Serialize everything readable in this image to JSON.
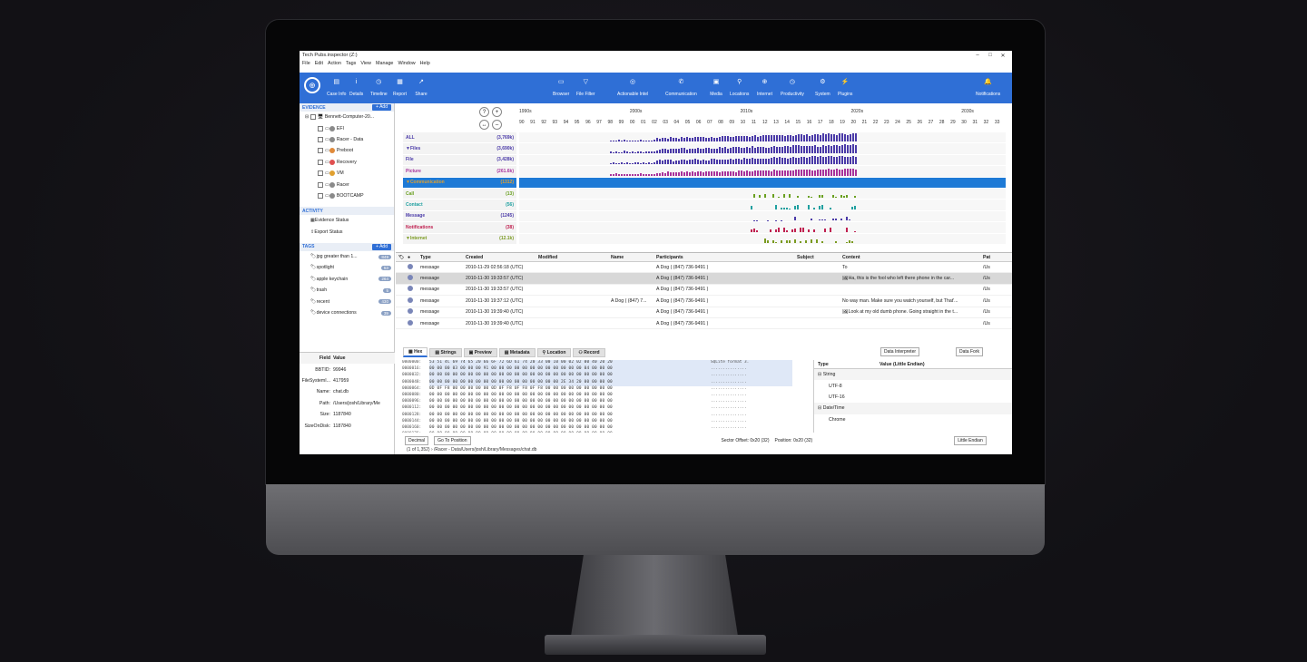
{
  "window": {
    "title": "Tech Pubs.inspector (Z:)"
  },
  "menu": [
    "File",
    "Edit",
    "Action",
    "Tags",
    "View",
    "Manage",
    "Window",
    "Help"
  ],
  "toolbar_left": [
    {
      "label": "Case Info",
      "icon": "document-icon"
    },
    {
      "label": "Details",
      "icon": "info-icon"
    },
    {
      "label": "Timeline",
      "icon": "clock-icon"
    },
    {
      "label": "Report",
      "icon": "report-icon"
    },
    {
      "label": "Share",
      "icon": "share-icon"
    }
  ],
  "toolbar_center": [
    {
      "label": "Browser",
      "icon": "folder-icon"
    },
    {
      "label": "File Filter",
      "icon": "filter-icon"
    },
    {
      "label": "Actionable Intel",
      "icon": "target-icon"
    },
    {
      "label": "Communication",
      "icon": "phone-icon"
    },
    {
      "label": "Media",
      "icon": "image-icon"
    },
    {
      "label": "Locations",
      "icon": "pin-icon"
    },
    {
      "label": "Internet",
      "icon": "globe-icon"
    },
    {
      "label": "Productivity",
      "icon": "clock-icon"
    },
    {
      "label": "System",
      "icon": "gear-icon"
    },
    {
      "label": "Plugins",
      "icon": "plug-icon"
    }
  ],
  "toolbar_right": {
    "label": "Notifications",
    "icon": "bell-icon"
  },
  "evidence": {
    "title": "EVIDENCE",
    "add": "+ Add",
    "root": "Bennett-Computer-20...",
    "items": [
      "EFI",
      "Racer - Data",
      "Preboot",
      "Recovery",
      "VM",
      "Racer",
      "BOOTCAMP"
    ]
  },
  "activity": {
    "title": "ACTIVITY",
    "items": [
      "Evidence Status",
      "Export Status"
    ]
  },
  "tags": {
    "title": "TAGS",
    "add": "+ Add",
    "items": [
      {
        "label": "jpg greater than 1...",
        "count": "849"
      },
      {
        "label": "spotlight",
        "count": "53"
      },
      {
        "label": "apple keychain",
        "count": "264"
      },
      {
        "label": "trash",
        "count": "5"
      },
      {
        "label": "recent",
        "count": "430"
      },
      {
        "label": "device connections",
        "count": "39"
      }
    ]
  },
  "metadata": {
    "headers": [
      "Field",
      "Value"
    ],
    "rows": [
      {
        "k": "BBTID:",
        "v": "99946"
      },
      {
        "k": "FileSystemI...",
        "v": "417959"
      },
      {
        "k": "Name:",
        "v": "chat.db"
      },
      {
        "k": "Path:",
        "v": "/Users/josh/Library/Me"
      },
      {
        "k": "Size:",
        "v": "1187840"
      },
      {
        "k": "SizeOnDisk:",
        "v": "1187840"
      }
    ]
  },
  "timeline": {
    "decades": [
      "1990s",
      "2000s",
      "2010s",
      "2020s",
      "2030s"
    ],
    "years": [
      "90",
      "91",
      "92",
      "93",
      "94",
      "95",
      "96",
      "97",
      "98",
      "99",
      "00",
      "01",
      "02",
      "03",
      "04",
      "05",
      "06",
      "07",
      "08",
      "09",
      "10",
      "11",
      "12",
      "13",
      "14",
      "15",
      "16",
      "17",
      "18",
      "19",
      "20",
      "21",
      "22",
      "23",
      "24",
      "25",
      "26",
      "27",
      "28",
      "29",
      "30",
      "31",
      "32",
      "33"
    ],
    "rows": [
      {
        "label": "ALL",
        "count": "(3,769k)",
        "color": "#4a3aa8"
      },
      {
        "label": "▼Files",
        "count": "(3,690k)",
        "color": "#4a3aa8"
      },
      {
        "label": "File",
        "count": "(3,428k)",
        "color": "#4a3aa8"
      },
      {
        "label": "Picture",
        "count": "(261.6k)",
        "color": "#a8329b"
      },
      {
        "label": "▼Communication",
        "count": "(1312)",
        "color": "#e0a030"
      },
      {
        "label": "Call",
        "count": "(13)",
        "color": "#6aa020"
      },
      {
        "label": "Contact",
        "count": "(56)",
        "color": "#20a0a0"
      },
      {
        "label": "Message",
        "count": "(1245)",
        "color": "#4a3aa8"
      },
      {
        "label": "Notifications",
        "count": "(38)",
        "color": "#c02050"
      },
      {
        "label": "▼Internet",
        "count": "(12.1k)",
        "color": "#7a9a20"
      }
    ]
  },
  "table": {
    "headers": [
      "Type",
      "Created",
      "Modified",
      "Name",
      "Participants",
      "Subject",
      "Content",
      "Pat"
    ],
    "rows": [
      {
        "type": "message",
        "created": "2010-11-29 02:56:18 (UTC)",
        "modified": "",
        "name": "",
        "participants": "A Dog ( (847) 736-9491 )",
        "subject": "",
        "content": "To",
        "path": "/Us"
      },
      {
        "type": "message",
        "created": "2010-11-30 19:33:57 (UTC)",
        "modified": "",
        "name": "",
        "participants": "A Dog ( (847) 736-9491 )",
        "subject": "",
        "content": "🖼Ha, this is the fool who left there phone in the car...",
        "path": "/Us"
      },
      {
        "type": "message",
        "created": "2010-11-30 19:33:57 (UTC)",
        "modified": "",
        "name": "",
        "participants": "A Dog ( (847) 736-9491 )",
        "subject": "",
        "content": "",
        "path": "/Us"
      },
      {
        "type": "message",
        "created": "2010-11-30 19:37:12 (UTC)",
        "modified": "",
        "name": "A Dog ( (847) 7...",
        "participants": "A Dog ( (847) 736-9491 )",
        "subject": "",
        "content": "No way man. Make sure you watch yourself, but That'...",
        "path": "/Us"
      },
      {
        "type": "message",
        "created": "2010-11-30 19:39:40 (UTC)",
        "modified": "",
        "name": "",
        "participants": "A Dog ( (847) 736-9491 )",
        "subject": "",
        "content": "🖼Look at my old dumb phone. Going straight in the t...",
        "path": "/Us"
      },
      {
        "type": "message",
        "created": "2010-11-30 19:39:40 (UTC)",
        "modified": "",
        "name": "",
        "participants": "A Dog ( (847) 736-9491 )",
        "subject": "",
        "content": "",
        "path": "/Us"
      }
    ]
  },
  "bottom_tabs": [
    "Hex",
    "Strings",
    "Preview",
    "Metadata",
    "Location",
    "Record"
  ],
  "selects": {
    "interpreter": "Data Interpreter",
    "fork": "Data Fork",
    "endian": "Little Endian",
    "mode": "Decimal"
  },
  "hex": {
    "offsets": [
      "0000000:",
      "0000016:",
      "0000032:",
      "0000048:",
      "0000064:",
      "0000080:",
      "0000096:",
      "0000112:",
      "0000128:",
      "0000144:",
      "0000160:",
      "0000176:",
      "0000192:"
    ],
    "rows": [
      "53 51 4C 69 74 65 20 66 6F 72 6D 61 74 20 33 00 10 00 02 02 00 40 20 20",
      "00 00 00 03 00 00 00 91 00 00 00 00 00 00 00 00 00 00 00 00 04 00 00 00",
      "00 00 00 00 00 00 00 00 00 00 00 00 00 00 00 00 00 00 00 00 00 00 00 00",
      "00 00 00 00 00 00 00 00 00 00 00 00 00 00 00 00 00 2E 34 20 00 00 00 00",
      "0D 0F F8 00 00 00 00 00 0D 0F F8 0F F8 0F F8 00 00 00 00 00 00 00 00 00",
      "00 00 00 00 00 00 00 00 00 00 00 00 00 00 00 00 00 00 00 00 00 00 00 00",
      "00 00 00 00 00 00 00 00 00 00 00 00 00 00 00 00 00 00 00 00 00 00 00 00",
      "00 00 00 00 00 00 00 00 00 00 00 00 00 00 00 00 00 00 00 00 00 00 00 00",
      "00 00 00 00 00 00 00 00 00 00 00 00 00 00 00 00 00 00 00 00 00 00 00 00",
      "00 00 00 00 00 00 00 00 00 00 00 00 00 00 00 00 00 00 00 00 00 00 00 00",
      "00 00 00 00 00 00 00 00 00 00 00 00 00 00 00 00 00 00 00 00 00 00 00 00",
      "00 00 00 00 00 00 00 00 00 00 00 00 00 00 00 00 00 00 00 00 00 00 00 00",
      "00 00 00 00 00 00 00 00 00 00 00 00 00 00 00 00 00 00 00 00 00 00 00 00"
    ],
    "ascii": [
      "SQLite format 3.",
      "...............",
      "...............",
      "...............",
      "...............",
      "...............",
      "...............",
      "...............",
      "...............",
      "...............",
      "...............",
      "...............",
      "..............."
    ]
  },
  "interpreter": {
    "headers": [
      "Type",
      "Value (Little Endian)"
    ],
    "rows": [
      {
        "label": "⊟ String",
        "indent": 0
      },
      {
        "label": "UTF-8",
        "indent": 1
      },
      {
        "label": "UTF-16",
        "indent": 1
      },
      {
        "label": "⊟ Date/Time",
        "indent": 0
      },
      {
        "label": "Chrome",
        "indent": 1
      }
    ]
  },
  "status": {
    "goto": "Go To Position",
    "sector": "Sector Offset: 0x20 (32)",
    "position": "Position: 0x20 (32)"
  },
  "path": "(1 of 1,352)  ›  /Racer - Data/Users/josh/Library/Messages/chat.db"
}
